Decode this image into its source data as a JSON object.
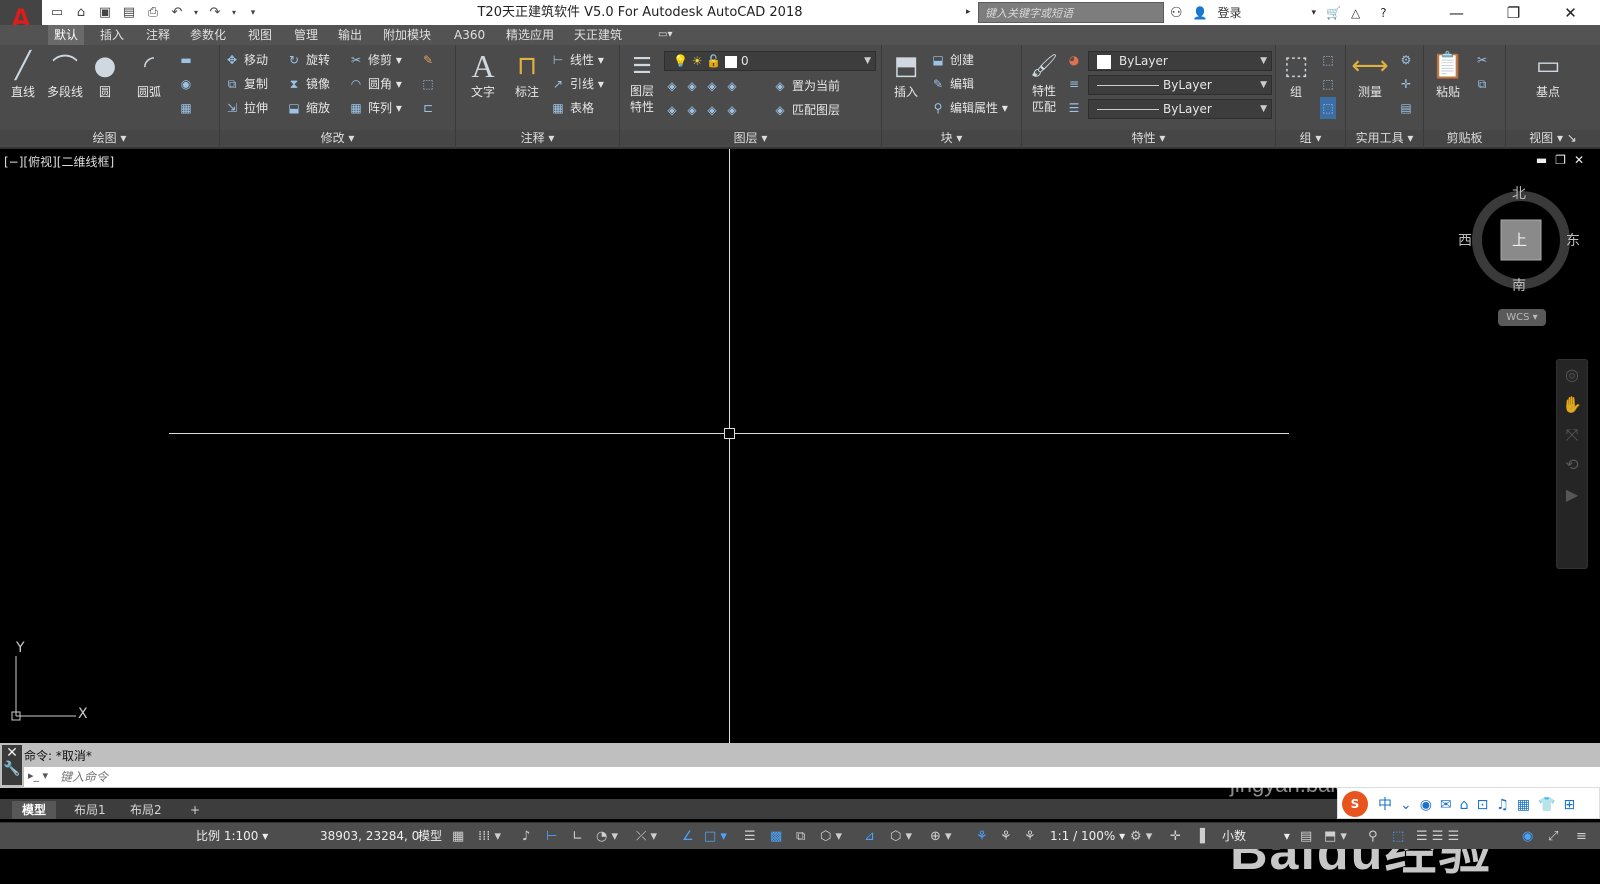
{
  "app": {
    "logo_letter": "A",
    "title": "T20天正建筑软件 V5.0 For Autodesk AutoCAD 2018"
  },
  "search": {
    "placeholder": "键入关键字或短语"
  },
  "user": {
    "login_label": "登录"
  },
  "ribbon_tabs": [
    "默认",
    "插入",
    "注释",
    "参数化",
    "视图",
    "管理",
    "输出",
    "附加模块",
    "A360",
    "精选应用",
    "天正建筑"
  ],
  "panels": {
    "draw": {
      "title": "绘图",
      "line": "直线",
      "polyline": "多段线",
      "circle": "圆",
      "arc": "圆弧"
    },
    "modify": {
      "title": "修改",
      "move": "移动",
      "rotate": "旋转",
      "trim": "修剪",
      "copy": "复制",
      "mirror": "镜像",
      "fillet": "圆角",
      "stretch": "拉伸",
      "scale": "缩放",
      "array": "阵列"
    },
    "annotation": {
      "title": "注释",
      "text": "文字",
      "dimension": "标注",
      "linear": "线性",
      "leader": "引线",
      "table": "表格"
    },
    "layers": {
      "title": "图层",
      "layer_props": "图层特性",
      "current_layer": "0",
      "set_current": "置为当前",
      "match_layer": "匹配图层"
    },
    "block": {
      "title": "块",
      "insert": "插入",
      "create": "创建",
      "edit": "编辑",
      "edit_attr": "编辑属性"
    },
    "properties": {
      "title": "特性",
      "match": "特性匹配",
      "color": "ByLayer",
      "linetype": "ByLayer",
      "lineweight": "ByLayer"
    },
    "group": {
      "title": "组",
      "group": "组"
    },
    "utilities": {
      "title": "实用工具",
      "measure": "测量"
    },
    "clipboard": {
      "title": "剪贴板",
      "paste": "粘贴"
    },
    "view": {
      "title": "视图",
      "base": "基点"
    }
  },
  "viewport": {
    "label": "[−][俯视][二维线框]"
  },
  "viewcube": {
    "north": "北",
    "south": "南",
    "east": "东",
    "west": "西",
    "face": "上",
    "wcs": "WCS"
  },
  "ucs": {
    "x": "X",
    "y": "Y"
  },
  "command": {
    "history": "命令: *取消*",
    "placeholder": "键入命令"
  },
  "layout_tabs": [
    "模型",
    "布局1",
    "布局2"
  ],
  "status": {
    "scale": "比例 1:100",
    "coords": "38903, 23284, 0",
    "model": "模型",
    "anno_scale": "1:1 / 100%",
    "units": "小数"
  },
  "watermark": {
    "text": "Baidu经验",
    "url": "jingyan.baidu.com"
  }
}
